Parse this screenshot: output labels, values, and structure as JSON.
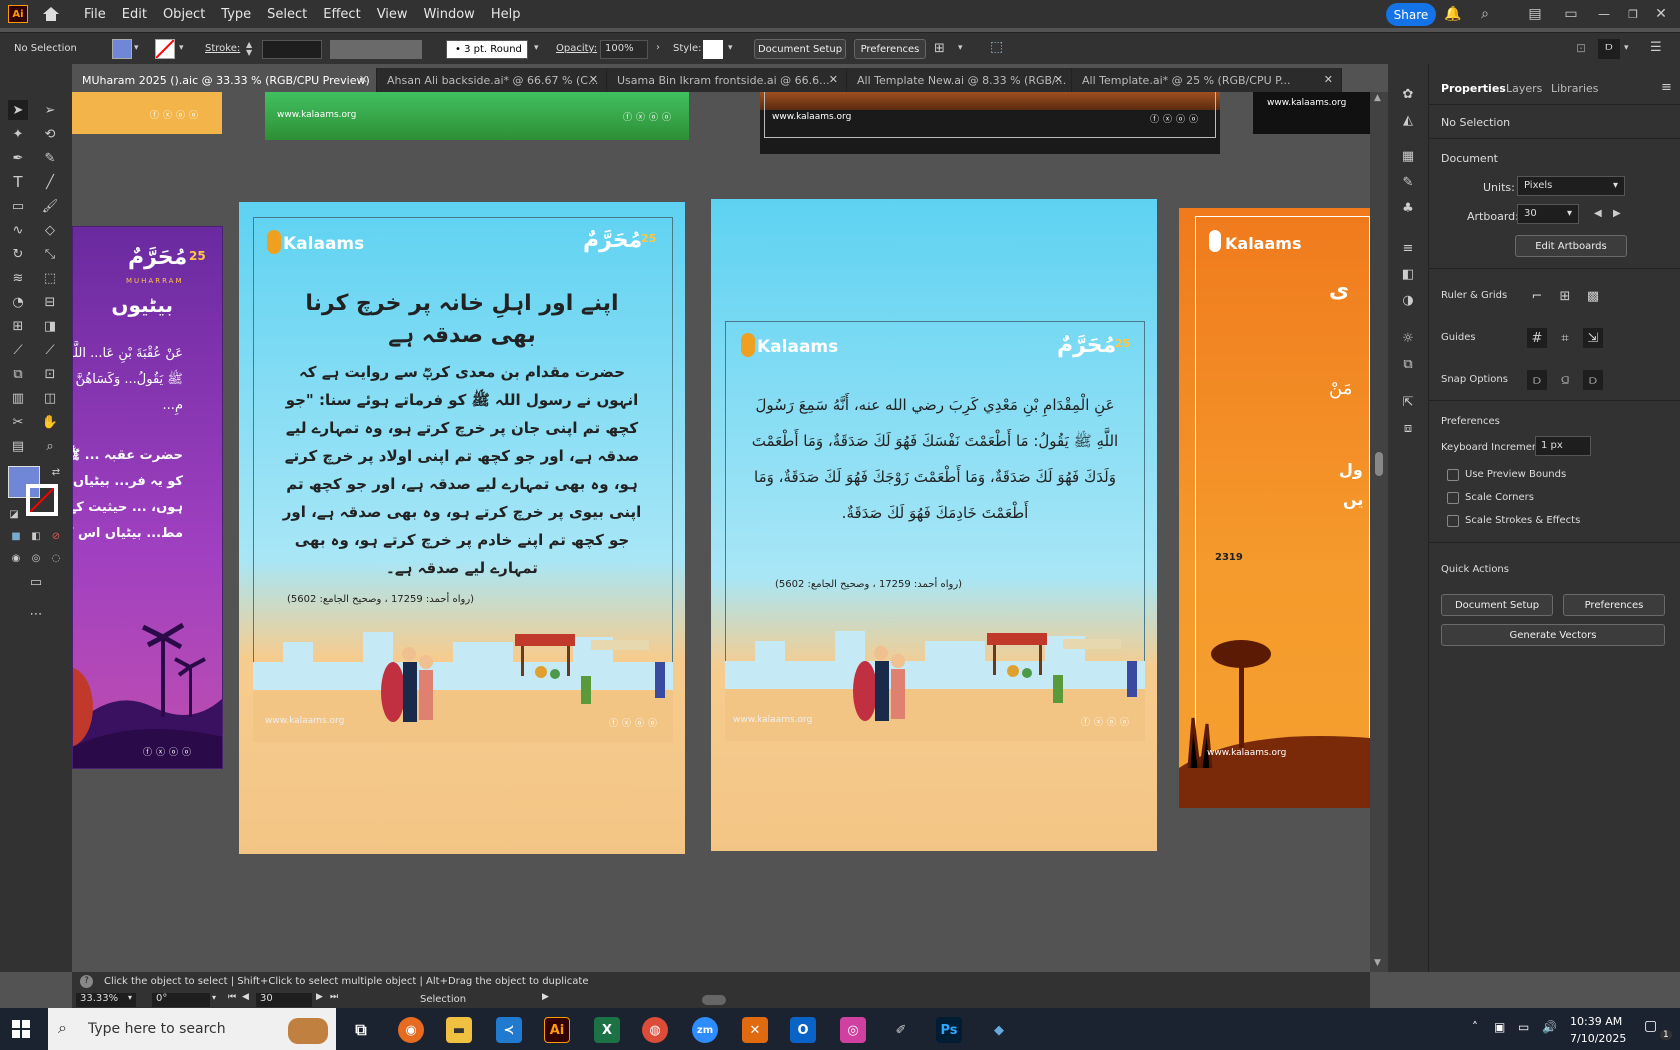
{
  "menubar": {
    "app_logo": "Ai",
    "items": [
      "File",
      "Edit",
      "Object",
      "Type",
      "Select",
      "Effect",
      "View",
      "Window",
      "Help"
    ],
    "share_label": "Share"
  },
  "control": {
    "selection": "No Selection",
    "stroke_label": "Stroke:",
    "brush": "3 pt. Round",
    "opacity_label": "Opacity:",
    "opacity_value": "100%",
    "style_label": "Style:",
    "doc_setup": "Document Setup",
    "preferences": "Preferences"
  },
  "tabs": [
    {
      "label": "MUharam 2025 ().aic @ 33.33 % (RGB/CPU Preview)",
      "active": true
    },
    {
      "label": "Ahsan Ali backside.ai* @ 66.67 % (C...",
      "active": false
    },
    {
      "label": "Usama Bin Ikram frontside.ai @ 66.6...",
      "active": false
    },
    {
      "label": "All Template New.ai @ 8.33 % (RGB/...",
      "active": false
    },
    {
      "label": "All Template.ai* @ 25 % (RGB/CPU P...",
      "active": false
    }
  ],
  "panel": {
    "tabs": [
      "Properties",
      "Layers",
      "Libraries"
    ],
    "no_selection": "No Selection",
    "document": "Document",
    "units_label": "Units:",
    "units_value": "Pixels",
    "artboard_label": "Artboard:",
    "artboard_value": "30",
    "edit_artboards": "Edit Artboards",
    "ruler_grids": "Ruler & Grids",
    "guides": "Guides",
    "snap_options": "Snap Options",
    "preferences": "Preferences",
    "keyboard_increment_label": "Keyboard Increment:",
    "keyboard_increment_value": "1 px",
    "use_preview_bounds": "Use Preview Bounds",
    "scale_corners": "Scale Corners",
    "scale_strokes": "Scale Strokes & Effects",
    "quick_actions": "Quick Actions",
    "document_setup_btn": "Document Setup",
    "preferences_btn": "Preferences",
    "generate_vectors": "Generate Vectors"
  },
  "artwork": {
    "website": "www.kalaams.org",
    "brand": "Kalaams",
    "muharram": "مُحَرَّمٌ",
    "number_25": "25",
    "muharram_latin": "MUHARRAM",
    "left_title": "اپنے اور اہلِ خانہ پر خرچ کرنا بھی صدقہ ہے",
    "left_body": "حضرت مقدام بن معدی کربؓ سے روایت ہے کہ انہوں نے رسول اللہ ﷺ کو فرماتے ہوئے سنا: \"جو کچھ تم اپنی جان پر خرچ کرتے ہو، وہ تمہارے لیے صدقہ ہے، اور جو کچھ تم اپنی اولاد پر خرچ کرتے ہو، وہ بھی تمہارے لیے صدقہ ہے، اور جو کچھ تم اپنی بیوی پر خرچ کرتے ہو، وہ بھی صدقہ ہے، اور جو کچھ تم اپنے خادم پر خرچ کرتے ہو، وہ بھی تمہارے لیے صدقہ ہے۔",
    "ref": "(رواه أحمد: 17259 ، وصحيح الجامع: 5602)",
    "right_arabic": "عَنِ الْمِقْدَامِ بْنِ مَعْدِي كَرِبَ رضي الله عنه، أَنَّهُ سَمِعَ رَسُولَ اللَّهِ ﷺ يَقُولُ: مَا أَطْعَمْتَ نَفْسَكَ فَهُوَ لَكَ صَدَقَةٌ، وَمَا أَطْعَمْتَ وَلَدَكَ فَهُوَ لَكَ صَدَقَةٌ، وَمَا أَطْعَمْتَ زَوْجَكَ فَهُوَ لَكَ صَدَقَةٌ، وَمَا أَطْعَمْتَ خَادِمَكَ فَهُوَ لَكَ صَدَقَةٌ.",
    "purple_line1": "بیٹیوں",
    "purple_arabic": "عَنْ عُقْبَةَ بْنِ عَا... اللَّهِ ﷺ يَقُولُ... وَكَسَاهُنَّ مِ...",
    "purple_urdu": "حضرت عقبہ ... ﷺ کو یہ فر... بیٹیاں ہوں، ... حیثیت کے مط... بیٹیاں اس کے",
    "orange_fragment": "2319",
    "orange_text1": "ی",
    "orange_text2": "مَنْ",
    "orange_text3": "ول",
    "orange_text4": "یں"
  },
  "status": {
    "hint": "Click the object to select  |  Shift+Click to select multiple object  |  Alt+Drag the object to duplicate",
    "zoom": "33.33%",
    "rotation": "0°",
    "artboard_num": "30",
    "tool": "Selection"
  },
  "taskbar": {
    "search_placeholder": "Type here to search",
    "time": "10:39 AM",
    "date": "7/10/2025",
    "notif_count": "1"
  },
  "colors": {
    "sky": "#66d0f0",
    "sand": "#f5c98a",
    "purple": "#8e3bb8",
    "orange": "#f58a1f",
    "accent": "#1473e6"
  }
}
